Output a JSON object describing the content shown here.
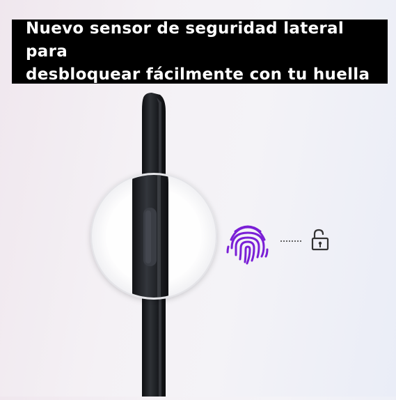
{
  "banner": {
    "line1": "Nuevo sensor de seguridad lateral para",
    "line2": "desbloquear fácilmente con tu huella"
  },
  "icons": {
    "phone": "phone-side-view",
    "magnifier": "zoom-circle-side-sensor",
    "fingerprint": "fingerprint-icon",
    "connector": "dotted-line",
    "lock": "unlocked-padlock-icon"
  },
  "colors": {
    "banner_bg": "#000000",
    "banner_text": "#ffffff",
    "fingerprint": "#7a1fd6",
    "phone_body": "#202226",
    "lock": "#333333"
  }
}
